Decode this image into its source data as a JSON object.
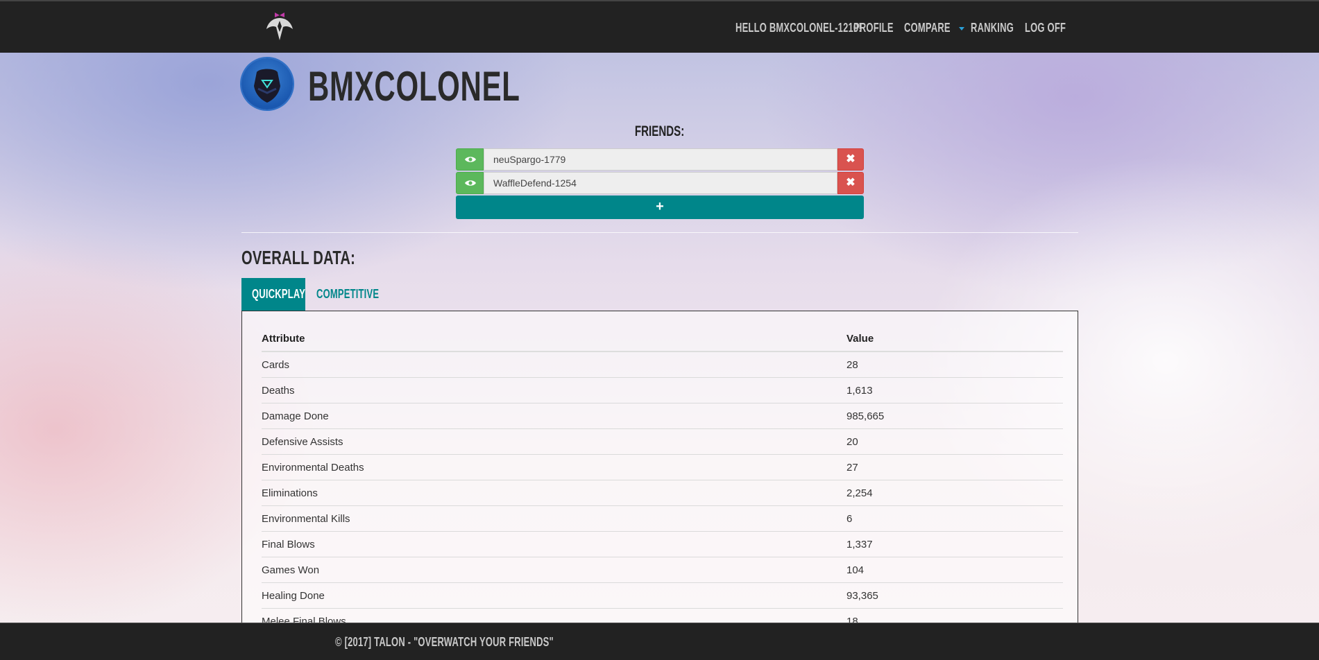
{
  "nav": {
    "greeting": "HELLO BMXCOLONEL-1210!",
    "profile": "PROFILE",
    "compare": "COMPARE",
    "ranking": "RANKING",
    "logoff": "LOG OFF"
  },
  "profile": {
    "username": "BMXCOLONEL"
  },
  "friends": {
    "title": "FRIENDS:",
    "list": [
      {
        "name": "neuSpargo-1779"
      },
      {
        "name": "WaffleDefend-1254"
      }
    ],
    "add_label": "+",
    "remove_label": "✖"
  },
  "overall": {
    "title": "OVERALL DATA:",
    "tabs": [
      "QUICKPLAY",
      "COMPETITIVE"
    ],
    "active_tab": "QUICKPLAY",
    "headers": {
      "attribute": "Attribute",
      "value": "Value"
    },
    "rows": [
      {
        "attribute": "Cards",
        "value": "28"
      },
      {
        "attribute": "Deaths",
        "value": "1,613"
      },
      {
        "attribute": "Damage Done",
        "value": "985,665"
      },
      {
        "attribute": "Defensive Assists",
        "value": "20"
      },
      {
        "attribute": "Environmental Deaths",
        "value": "27"
      },
      {
        "attribute": "Eliminations",
        "value": "2,254"
      },
      {
        "attribute": "Environmental Kills",
        "value": "6"
      },
      {
        "attribute": "Final Blows",
        "value": "1,337"
      },
      {
        "attribute": "Games Won",
        "value": "104"
      },
      {
        "attribute": "Healing Done",
        "value": "93,365"
      },
      {
        "attribute": "Melee Final Blows",
        "value": "18"
      }
    ]
  },
  "footer": {
    "text": "© [2017] TALON - \"OVERWATCH YOUR FRIENDS\""
  },
  "colors": {
    "accent": "#00868a",
    "success": "#5cb85c",
    "danger": "#d9534f",
    "navbar": "#222222"
  }
}
